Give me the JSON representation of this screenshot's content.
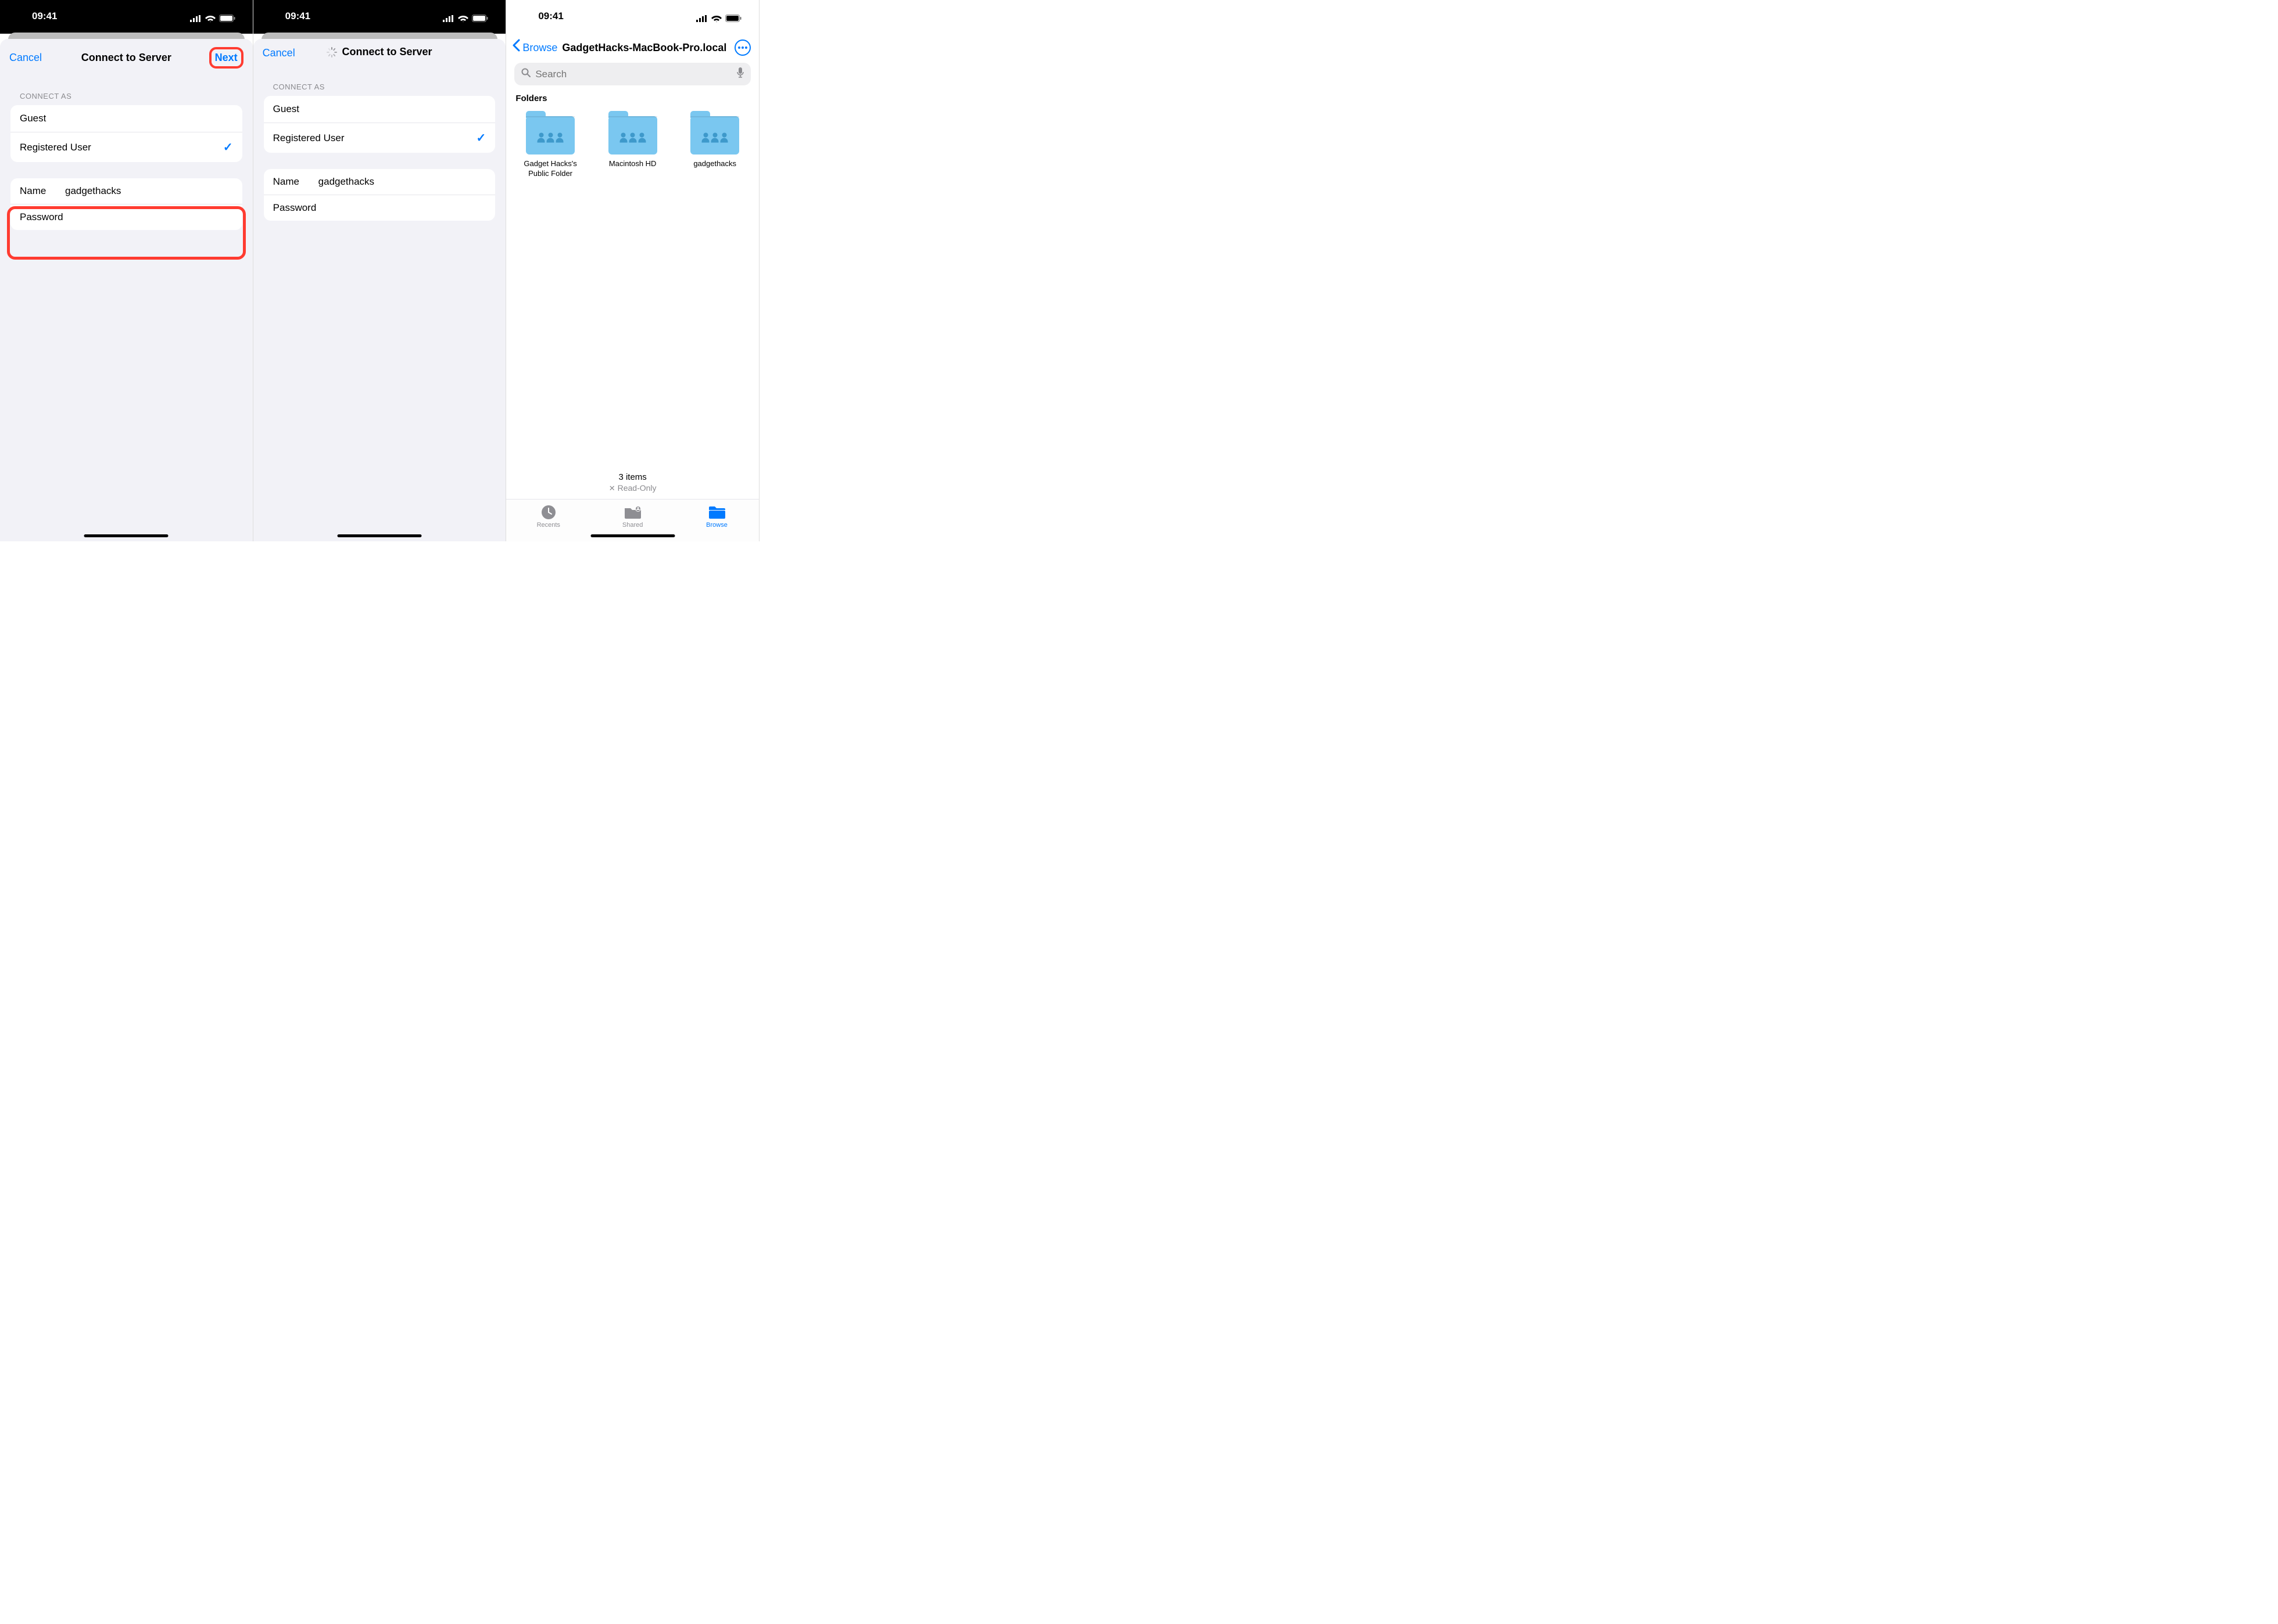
{
  "status": {
    "time": "09:41"
  },
  "pane1": {
    "cancel": "Cancel",
    "title": "Connect to Server",
    "next": "Next",
    "section_label": "CONNECT AS",
    "opt_guest": "Guest",
    "opt_registered": "Registered User",
    "name_label": "Name",
    "name_value": "gadgethacks",
    "password_label": "Password",
    "password_value": ""
  },
  "pane2": {
    "cancel": "Cancel",
    "title": "Connect to Server",
    "section_label": "CONNECT AS",
    "opt_guest": "Guest",
    "opt_registered": "Registered User",
    "name_label": "Name",
    "name_value": "gadgethacks",
    "password_label": "Password",
    "password_value": ""
  },
  "pane3": {
    "back_label": "Browse",
    "title": "GadgetHacks-MacBook-Pro.local",
    "search_placeholder": "Search",
    "folders_label": "Folders",
    "folders": [
      {
        "name": "Gadget Hacks's Public Folder"
      },
      {
        "name": "Macintosh HD"
      },
      {
        "name": "gadgethacks"
      }
    ],
    "item_count": "3 items",
    "readonly": "Read-Only",
    "tabs": {
      "recents": "Recents",
      "shared": "Shared",
      "browse": "Browse"
    }
  }
}
